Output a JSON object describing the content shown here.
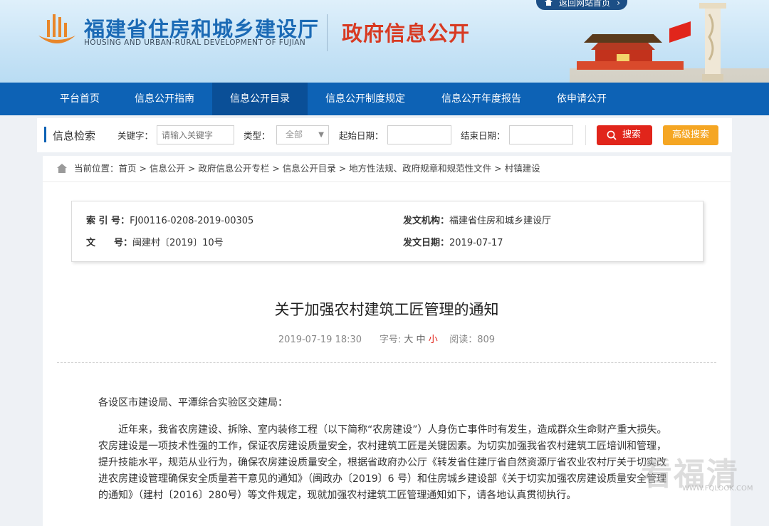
{
  "header": {
    "title": "福建省住房和城乡建设厅",
    "subtitle": "HOUSING AND URBAN-RURAL DEVELOPMENT OF FUJIAN",
    "section": "政府信息公开",
    "back_home": "返回网站首页"
  },
  "nav": {
    "items": [
      "平台首页",
      "信息公开指南",
      "信息公开目录",
      "信息公开制度规定",
      "信息公开年度报告",
      "依申请公开"
    ],
    "active_index": 2
  },
  "search": {
    "title": "信息检索",
    "keyword_label": "关键字：",
    "keyword_placeholder": "请输入关键字",
    "type_label": "类型：",
    "type_value": "全部",
    "start_label": "起始日期：",
    "end_label": "结束日期：",
    "search_button": "搜索",
    "advanced_button": "高级搜索"
  },
  "breadcrumb": {
    "text": "当前位置：首页 > 信息公开 > 政府信息公开专栏 > 信息公开目录 > 地方性法规、政府规章和规范性文件 > 村镇建设"
  },
  "meta": {
    "index_label": "索 引 号：",
    "index_value": "FJ00116-0208-2019-00305",
    "issuer_label": "发文机构：",
    "issuer_value": "福建省住房和城乡建设厅",
    "doc_no_label": "文　　号：",
    "doc_no_value": "闽建村〔2019〕10号",
    "date_label": "发文日期：",
    "date_value": "2019-07-17"
  },
  "article": {
    "title": "关于加强农村建筑工匠管理的通知",
    "publish_time": "2019-07-19 18:30",
    "font_label": "字号:",
    "font_large": "大",
    "font_medium": "中",
    "font_small": "小",
    "reads_label": "阅读：",
    "reads_value": "809",
    "addressee": "各设区市建设局、平潭综合实验区交建局：",
    "paragraph": "近年来，我省农房建设、拆除、室内装修工程（以下简称“农房建设”）人身伤亡事件时有发生，造成群众生命财产重大损失。农房建设是一项技术性强的工作，保证农房建设质量安全，农村建筑工匠是关键因素。为切实加强我省农村建筑工匠培训和管理，提升技能水平，规范从业行为，确保农房建设质量安全，根据省政府办公厅《转发省住建厅省自然资源厅省农业农村厅关于切实改进农房建设管理确保安全质量若干意见的通知》（闽政办〔2019〕6 号）和住房城乡建设部《关于切实加强农房建设质量安全管理的通知》（建村〔2016〕280号）等文件规定，现就加强农村建筑工匠管理通知如下，请各地认真贯彻执行。"
  },
  "watermark": {
    "text": "看福清",
    "url": "WWW.FQLOOK.COM"
  },
  "colors": {
    "nav_blue": "#0d62b5",
    "title_blue": "#1b6ab5",
    "title_red": "#d83a22",
    "search_red": "#e1251b",
    "advanced_orange": "#f5a623"
  }
}
